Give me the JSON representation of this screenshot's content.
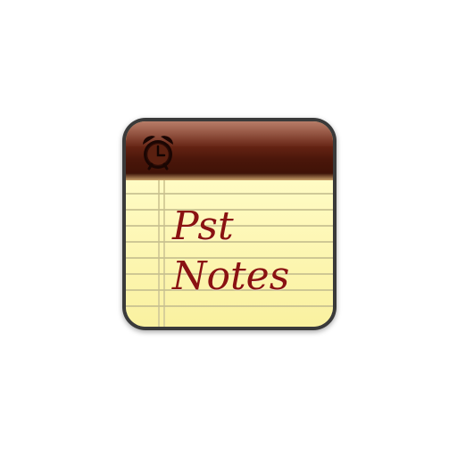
{
  "app": {
    "title_line1": "Pst",
    "title_line2": "Notes",
    "icon": "alarm-clock-icon"
  },
  "colors": {
    "frame": "#3a3a3a",
    "header": "#4a160a",
    "paper": "#fbf5a8",
    "text": "#8a1212"
  }
}
